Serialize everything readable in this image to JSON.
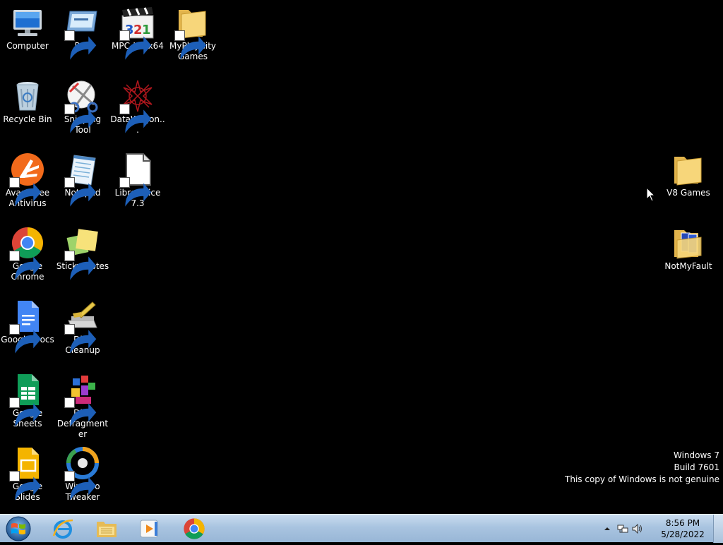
{
  "desktop": {
    "icons": [
      {
        "label": "Computer",
        "icon": "computer-icon"
      },
      {
        "label": "Run",
        "icon": "run-icon"
      },
      {
        "label": "MPC-HC x64",
        "icon": "mpc-hc-icon"
      },
      {
        "label": "MyPlayCity Games",
        "icon": "folder-icon"
      },
      {
        "label": "Recycle Bin",
        "icon": "recycle-bin-icon"
      },
      {
        "label": "Snipping Tool",
        "icon": "snipping-tool-icon"
      },
      {
        "label": "DataWagon...",
        "icon": "datawagon-icon"
      },
      {
        "label": "Avast Free Antivirus",
        "icon": "avast-icon"
      },
      {
        "label": "Notepad",
        "icon": "notepad-icon"
      },
      {
        "label": "LibreOffice 7.3",
        "icon": "libreoffice-icon"
      },
      {
        "label": "Google Chrome",
        "icon": "chrome-icon"
      },
      {
        "label": "Sticky Notes",
        "icon": "sticky-notes-icon"
      },
      {
        "label": "Google Docs",
        "icon": "google-docs-icon"
      },
      {
        "label": "Disk Cleanup",
        "icon": "disk-cleanup-icon"
      },
      {
        "label": "Google Sheets",
        "icon": "google-sheets-icon"
      },
      {
        "label": "Disk Defragmenter",
        "icon": "disk-defragmenter-icon"
      },
      {
        "label": "Google Slides",
        "icon": "google-slides-icon"
      },
      {
        "label": "Winaero Tweaker",
        "icon": "winaero-tweaker-icon"
      },
      {
        "label": "V8 Games",
        "icon": "folder-icon"
      },
      {
        "label": "NotMyFault",
        "icon": "folder-icon"
      }
    ]
  },
  "watermark": {
    "line1": "Windows 7",
    "line2": "Build 7601",
    "line3": "This copy of Windows is not genuine"
  },
  "taskbar": {
    "start_icon": "windows-start-orb-icon",
    "pinned": [
      {
        "icon": "internet-explorer-icon"
      },
      {
        "icon": "windows-explorer-icon"
      },
      {
        "icon": "windows-media-player-icon"
      },
      {
        "icon": "chrome-icon"
      }
    ],
    "tray": {
      "time": "8:56 PM",
      "date": "5/28/2022"
    }
  }
}
